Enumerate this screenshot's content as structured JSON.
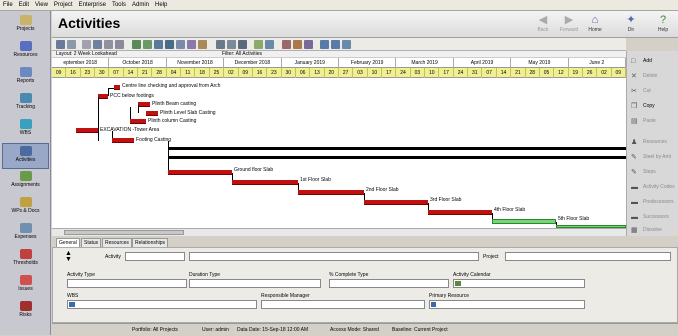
{
  "menu": [
    "File",
    "Edit",
    "View",
    "Project",
    "Enterprise",
    "Tools",
    "Admin",
    "Help"
  ],
  "nav": [
    {
      "label": "Projects",
      "icon": "projects-icon",
      "color": "#c9b36a"
    },
    {
      "label": "Resources",
      "icon": "resources-icon",
      "color": "#5a6fc0"
    },
    {
      "label": "Reports",
      "icon": "reports-icon",
      "color": "#6c8ac0"
    },
    {
      "label": "Tracking",
      "icon": "tracking-icon",
      "color": "#4a8ab0"
    },
    {
      "label": "WBS",
      "icon": "wbs-icon",
      "color": "#3aa0c0"
    },
    {
      "label": "Activities",
      "icon": "activities-icon",
      "color": "#4a6aa0"
    },
    {
      "label": "Assignments",
      "icon": "assignments-icon",
      "color": "#6a9a4a"
    },
    {
      "label": "WPs & Docs",
      "icon": "docs-icon",
      "color": "#c0a040"
    },
    {
      "label": "Expenses",
      "icon": "expenses-icon",
      "color": "#7090b0"
    },
    {
      "label": "Thresholds",
      "icon": "thresholds-icon",
      "color": "#c04040"
    },
    {
      "label": "Issues",
      "icon": "issues-icon",
      "color": "#d05050"
    },
    {
      "label": "Risks",
      "icon": "risks-icon",
      "color": "#a03030"
    }
  ],
  "header": {
    "title": "Activities",
    "buttons": [
      {
        "label": "Back",
        "glyph": "◀"
      },
      {
        "label": "Forward",
        "glyph": "▶"
      },
      {
        "label": "Home",
        "glyph": "⌂"
      },
      {
        "label": "Dir",
        "glyph": "✦"
      },
      {
        "label": "Help",
        "glyph": "?"
      }
    ]
  },
  "gantt": {
    "layout": "Layout: 2 Week Lookahead",
    "filter": "Filter: All Activities",
    "months": [
      "eptember 2018",
      "October 2018",
      "November 2018",
      "December 2018",
      "January 2019",
      "February 2019",
      "March 2019",
      "April 2019",
      "May 2019",
      "June 2"
    ],
    "weeks": [
      "09",
      "16",
      "23",
      "30",
      "07",
      "14",
      "21",
      "28",
      "04",
      "11",
      "18",
      "25",
      "02",
      "09",
      "16",
      "23",
      "30",
      "06",
      "13",
      "20",
      "27",
      "03",
      "10",
      "17",
      "24",
      "03",
      "10",
      "17",
      "24",
      "31",
      "07",
      "14",
      "21",
      "28",
      "05",
      "12",
      "19",
      "26",
      "02",
      "09"
    ],
    "labels": {
      "centre": "Centre line checking and approval from Arch",
      "pcc": "PCC below footings",
      "plinth_beam": "Plinth Beam casting",
      "plinth_slab": "Plinth Level Slab Casting",
      "plinth_col": "Plinth column Casting",
      "excavation": "EXCAVATION -Tower Area",
      "footing": "Footing Casting",
      "ground": "Ground floor Slab",
      "first": "1st Floor Slab",
      "second": "2nd Floor Slab",
      "third": "3rd Floor Slab",
      "fourth": "4th Floor Slab",
      "fifth": "5th Floor Slab"
    }
  },
  "actions": [
    {
      "label": "Add",
      "icon": "add-icon",
      "glyph": "□",
      "enabled": true
    },
    {
      "label": "Delete",
      "icon": "delete-icon",
      "glyph": "✕",
      "enabled": false
    },
    {
      "label": "Cut",
      "icon": "cut-icon",
      "glyph": "✂",
      "enabled": false
    },
    {
      "label": "Copy",
      "icon": "copy-icon",
      "glyph": "❐",
      "enabled": true
    },
    {
      "label": "Paste",
      "icon": "paste-icon",
      "glyph": "▤",
      "enabled": false
    },
    {
      "label": "Resources",
      "icon": "resources-icon",
      "glyph": "♟",
      "enabled": false
    },
    {
      "label": "Steel by Amt",
      "icon": "steel-icon",
      "glyph": "✎",
      "enabled": false
    },
    {
      "label": "Steps",
      "icon": "steps-icon",
      "glyph": "✎",
      "enabled": false
    },
    {
      "label": "Activity Codes",
      "icon": "activity-codes-icon",
      "glyph": "▬",
      "enabled": false
    },
    {
      "label": "Predecessors",
      "icon": "predecessors-icon",
      "glyph": "▬",
      "enabled": false
    },
    {
      "label": "Successors",
      "icon": "successors-icon",
      "glyph": "▬",
      "enabled": false
    },
    {
      "label": "Dissolve",
      "icon": "dissolve-icon",
      "glyph": "▦",
      "enabled": false
    }
  ],
  "tabs": [
    "General",
    "Status",
    "Resources",
    "Relationships"
  ],
  "details": {
    "activity_label": "Activity",
    "project_label": "Project",
    "activity_type_label": "Activity Type",
    "duration_type_label": "Duration Type",
    "pct_complete_type_label": "% Complete Type",
    "activity_calendar_label": "Activity Calendar",
    "wbs_label": "WBS",
    "responsible_manager_label": "Responsible Manager",
    "primary_resource_label": "Primary Resource"
  },
  "status": {
    "portfolio": "Portfolio: All Projects",
    "user": "User: admin",
    "data_date": "Data Date: 15-Sep-18 12:00 AM",
    "access": "Access Mode: Shared",
    "baseline": "Baseline: Current Project"
  }
}
